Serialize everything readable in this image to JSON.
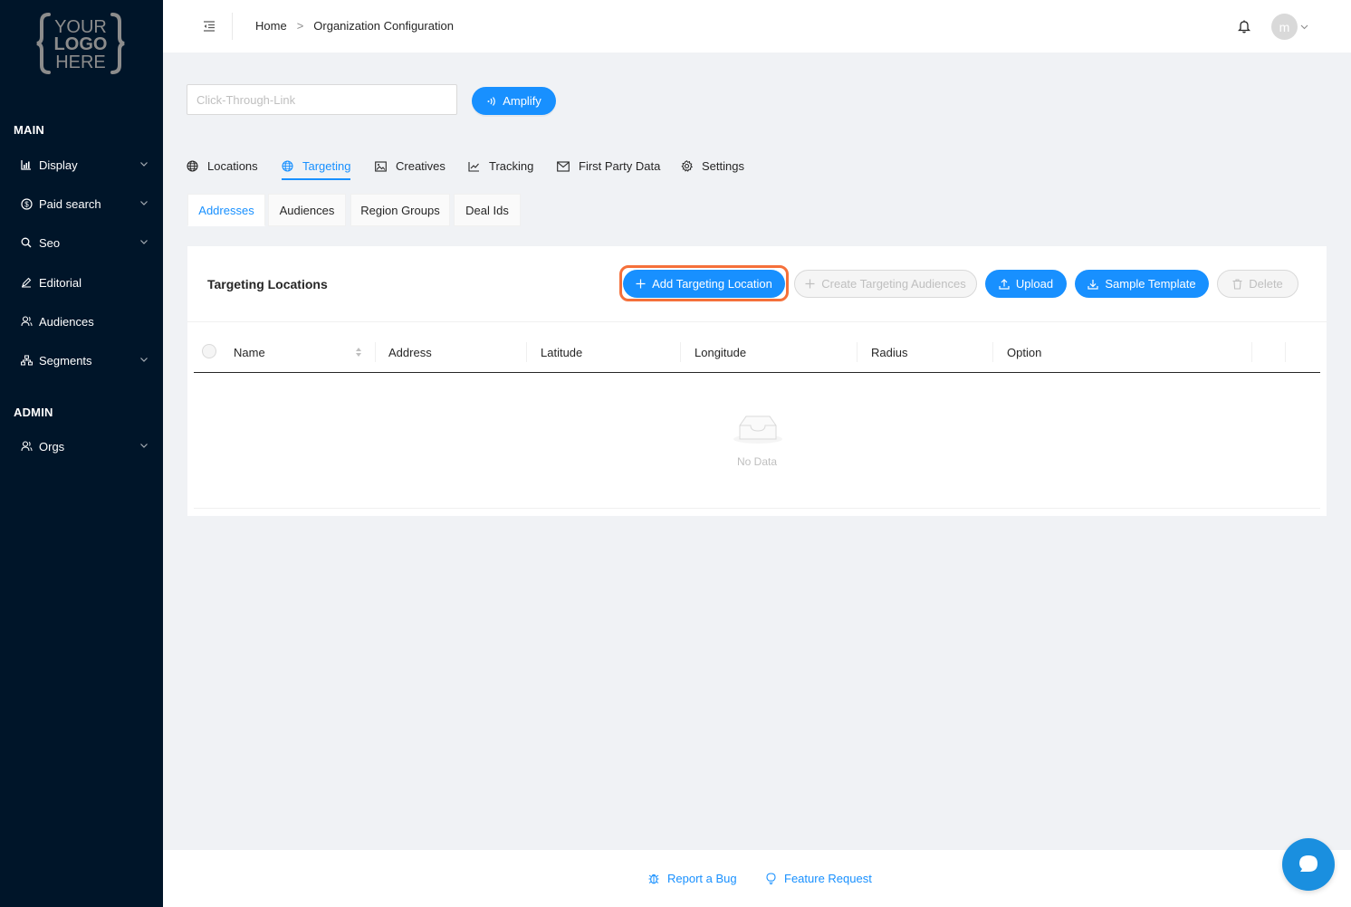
{
  "sidebar": {
    "logo": {
      "text_lines": [
        "YOUR",
        "LOGO",
        "HERE"
      ]
    },
    "main_label": "MAIN",
    "admin_label": "ADMIN",
    "main_items": [
      {
        "label": "Display",
        "icon": "chart-icon",
        "has_submenu": true
      },
      {
        "label": "Paid search",
        "icon": "dollar-circle-icon",
        "has_submenu": true
      },
      {
        "label": "Seo",
        "icon": "search-icon",
        "has_submenu": true
      },
      {
        "label": "Editorial",
        "icon": "pen-icon",
        "has_submenu": false
      },
      {
        "label": "Audiences",
        "icon": "users-icon",
        "has_submenu": false
      },
      {
        "label": "Segments",
        "icon": "cluster-icon",
        "has_submenu": true
      }
    ],
    "admin_items": [
      {
        "label": "Orgs",
        "icon": "users-icon",
        "has_submenu": true
      }
    ]
  },
  "header": {
    "breadcrumb": {
      "home": "Home",
      "separator": ">",
      "current": "Organization Configuration"
    },
    "avatar_initial": "m"
  },
  "toolbar": {
    "link_placeholder": "Click-Through-Link",
    "link_value": "",
    "amplify_label": "Amplify"
  },
  "tabs": [
    {
      "label": "Locations",
      "icon": "globe-icon",
      "active": false
    },
    {
      "label": "Targeting",
      "icon": "globe-icon",
      "active": true
    },
    {
      "label": "Creatives",
      "icon": "picture-icon",
      "active": false
    },
    {
      "label": "Tracking",
      "icon": "line-chart-icon",
      "active": false
    },
    {
      "label": "First Party Data",
      "icon": "mail-icon",
      "active": false
    },
    {
      "label": "Settings",
      "icon": "gear-icon",
      "active": false
    }
  ],
  "subtabs": [
    {
      "label": "Addresses",
      "active": true
    },
    {
      "label": "Audiences",
      "active": false
    },
    {
      "label": "Region Groups",
      "active": false
    },
    {
      "label": "Deal Ids",
      "active": false
    }
  ],
  "card": {
    "title": "Targeting Locations",
    "buttons": {
      "add": "Add Targeting Location",
      "create_audiences": "Create Targeting Audiences",
      "upload": "Upload",
      "sample_template": "Sample Template",
      "delete": "Delete"
    },
    "columns": [
      "Name",
      "Address",
      "Latitude",
      "Longitude",
      "Radius",
      "Option"
    ],
    "rows": [],
    "empty_text": "No Data"
  },
  "footer": {
    "report_bug": "Report a Bug",
    "feature_request": "Feature Request"
  },
  "colors": {
    "sidebar_bg": "#001529",
    "primary": "#1890ff",
    "highlight": "#f5703a",
    "page_bg": "#f0f2f5"
  }
}
